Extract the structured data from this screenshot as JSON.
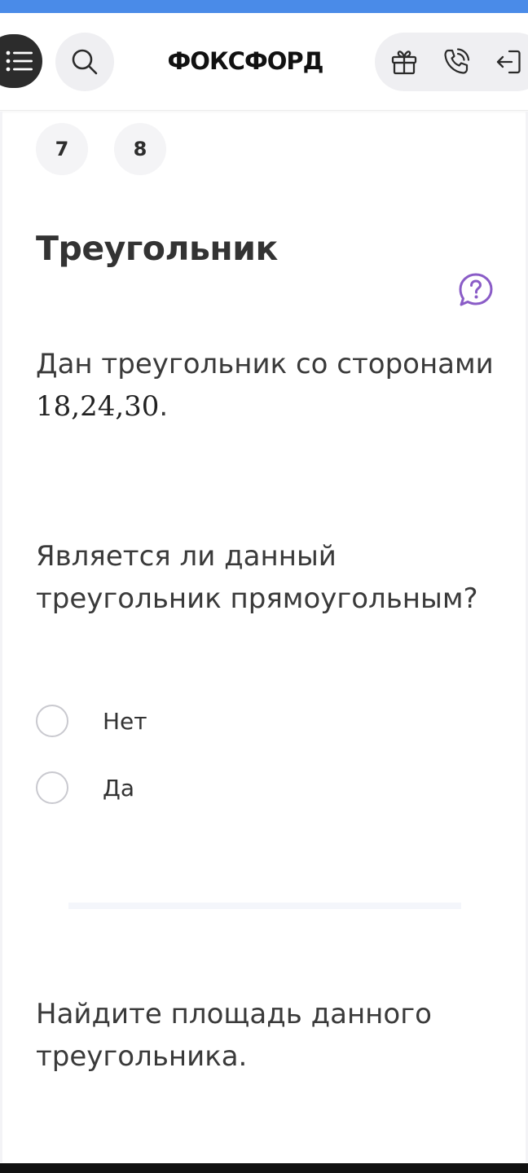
{
  "header": {
    "logo": "ФОКСФОРД",
    "icons": [
      "menu-icon",
      "search-icon",
      "gift-icon",
      "phone-icon",
      "login-icon"
    ]
  },
  "task_nav": {
    "items": [
      "7",
      "8"
    ]
  },
  "task": {
    "title": "Треугольник",
    "statement_text": "Дан треугольник со сторонами",
    "statement_math": "18,24,30",
    "statement_end": ".",
    "question1_line1": "Является ли данный",
    "question1_line2": "треугольник прямоугольным?",
    "options": [
      "Нет",
      "Да"
    ],
    "question2_line1": "Найдите площадь данного",
    "question2_line2": "треугольника."
  },
  "colors": {
    "top_bar": "#4a8be8",
    "help_icon": "#8a5cc7",
    "menu_button": "#2c2c2c",
    "pill_background": "#efeff2"
  }
}
